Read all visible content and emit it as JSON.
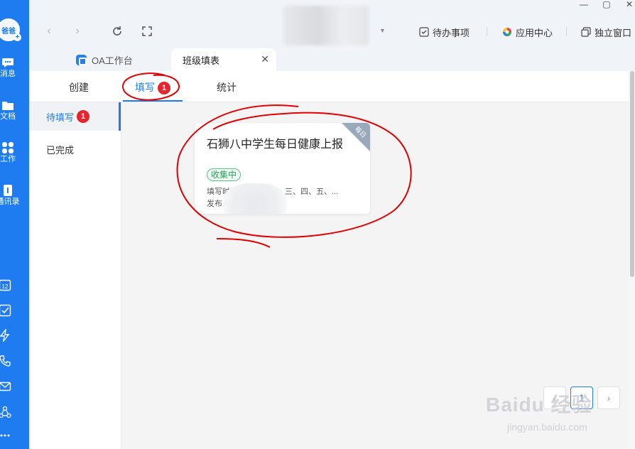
{
  "rail": {
    "avatar_text": "爸爸",
    "items": [
      {
        "label": "消息",
        "icon": "message-icon"
      },
      {
        "label": "文档",
        "icon": "document-icon"
      },
      {
        "label": "工作",
        "icon": "workspace-grid-icon"
      },
      {
        "label": "通讯录",
        "icon": "contacts-icon"
      }
    ],
    "calendar_day": "12",
    "bottom_icons": [
      "calendar-icon",
      "todo-check-icon",
      "lightning-icon",
      "phone-icon",
      "mail-icon",
      "org-icon",
      "more-icon"
    ]
  },
  "browser": {
    "back_icon": "‹",
    "forward_icon": "›",
    "tools": {
      "todo": "待办事项",
      "app_center": "应用中心",
      "standalone": "独立窗口"
    },
    "tabs": [
      {
        "label": "OA工作台",
        "active": false
      },
      {
        "label": "班级填表",
        "active": true
      }
    ]
  },
  "subtabs": {
    "create": "创建",
    "fill": "填写",
    "fill_badge": "1",
    "stats": "统计"
  },
  "side": {
    "pending": "待填写",
    "pending_badge": "1",
    "done": "已完成"
  },
  "card": {
    "title": "石狮八中学生每日健康上报",
    "corner": "每日",
    "status": "收集中",
    "fill_time": "填写时间：周一、二、三、四、五、...",
    "publisher": "发布人："
  },
  "pager": {
    "prev": "‹",
    "page": "1",
    "next": "›"
  },
  "watermark": {
    "main": "Baidu 经验",
    "sub": "jingyan.baidu.com"
  },
  "colors": {
    "brand": "#1f7cf0",
    "badge": "#e5242c",
    "status_green": "#22a35b",
    "annotation": "#e00000"
  }
}
